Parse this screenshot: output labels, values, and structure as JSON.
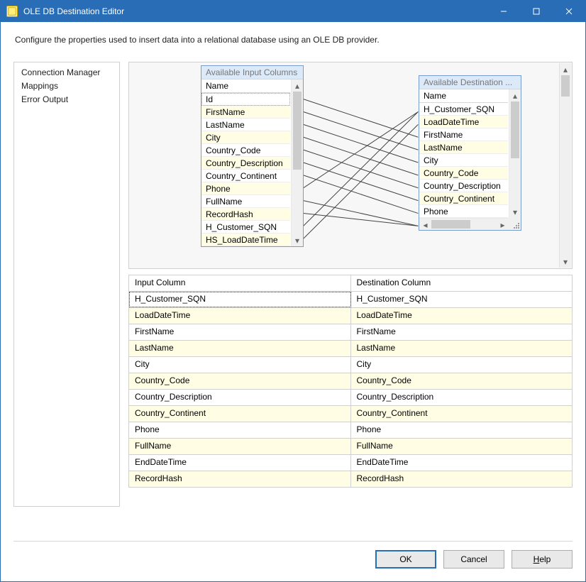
{
  "window": {
    "title": "OLE DB Destination Editor",
    "description": "Configure the properties used to insert data into a relational database using an OLE DB provider."
  },
  "sidebar": {
    "items": [
      {
        "label": "Connection Manager"
      },
      {
        "label": "Mappings"
      },
      {
        "label": "Error Output"
      }
    ]
  },
  "diagram": {
    "input_panel": {
      "title": "Available Input Columns",
      "header": "Name",
      "items": [
        "Id",
        "FirstName",
        "LastName",
        "City",
        "Country_Code",
        "Country_Description",
        "Country_Continent",
        "Phone",
        "FullName",
        "RecordHash",
        "H_Customer_SQN",
        "HS_LoadDateTime"
      ]
    },
    "dest_panel": {
      "title": "Available Destination ...",
      "header": "Name",
      "items": [
        "H_Customer_SQN",
        "LoadDateTime",
        "FirstName",
        "LastName",
        "City",
        "Country_Code",
        "Country_Description",
        "Country_Continent",
        "Phone"
      ]
    }
  },
  "grid": {
    "headers": {
      "left": "Input Column",
      "right": "Destination Column"
    },
    "rows": [
      {
        "l": "H_Customer_SQN",
        "r": "H_Customer_SQN",
        "selected": true
      },
      {
        "l": "LoadDateTime",
        "r": "LoadDateTime",
        "ylw": true
      },
      {
        "l": "FirstName",
        "r": "FirstName"
      },
      {
        "l": "LastName",
        "r": "LastName",
        "ylw": true
      },
      {
        "l": "City",
        "r": "City"
      },
      {
        "l": "Country_Code",
        "r": "Country_Code",
        "ylw": true
      },
      {
        "l": "Country_Description",
        "r": "Country_Description"
      },
      {
        "l": "Country_Continent",
        "r": "Country_Continent",
        "ylw": true
      },
      {
        "l": "Phone",
        "r": "Phone"
      },
      {
        "l": "FullName",
        "r": "FullName",
        "ylw": true
      },
      {
        "l": "EndDateTime",
        "r": "EndDateTime"
      },
      {
        "l": "RecordHash",
        "r": "RecordHash",
        "ylw": true
      }
    ]
  },
  "footer": {
    "ok": "OK",
    "cancel": "Cancel",
    "help": "Help"
  }
}
